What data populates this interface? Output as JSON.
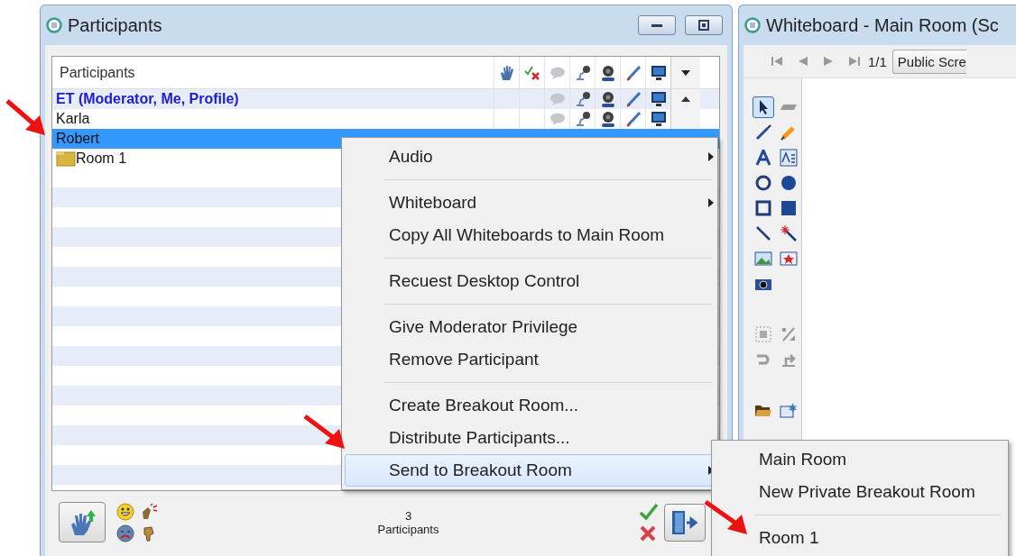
{
  "participants_window": {
    "title": "Participants",
    "list_header": "Participants",
    "rows": [
      {
        "name": "ET (Moderator, Me, Profile)",
        "kind": "moderator",
        "selected": false
      },
      {
        "name": "Karla",
        "kind": "participant",
        "selected": false
      },
      {
        "name": "Robert",
        "kind": "participant",
        "selected": true
      },
      {
        "name": "Room 1",
        "kind": "room",
        "selected": false
      }
    ],
    "count": "3",
    "count_label": "Participants"
  },
  "whiteboard_window": {
    "title": "Whiteboard - Main Room (Sc",
    "page": "1/1",
    "screen_select": "Public Scre"
  },
  "context_menu": {
    "groups": [
      {
        "items": [
          {
            "label": "Audio",
            "submenu": true,
            "selected": false
          }
        ]
      },
      {
        "items": [
          {
            "label": "Whiteboard",
            "submenu": true,
            "selected": false
          },
          {
            "label": "Copy All Whiteboards to Main Room",
            "submenu": false,
            "selected": false
          }
        ]
      },
      {
        "items": [
          {
            "label": "Recuest Desktop Control",
            "submenu": false,
            "selected": false
          }
        ]
      },
      {
        "items": [
          {
            "label": "Give Moderator Privilege",
            "submenu": false,
            "selected": false
          },
          {
            "label": "Remove Participant",
            "submenu": false,
            "selected": false
          }
        ]
      },
      {
        "items": [
          {
            "label": "Create Breakout Room...",
            "submenu": false,
            "selected": false
          },
          {
            "label": "Distribute Participants...",
            "submenu": false,
            "selected": false
          },
          {
            "label": "Send to Breakout Room",
            "submenu": true,
            "selected": true
          }
        ]
      }
    ]
  },
  "submenu": {
    "groups": [
      {
        "items": [
          {
            "label": "Main Room",
            "selected": false
          },
          {
            "label": "New Private Breakout Room",
            "selected": false
          }
        ]
      },
      {
        "items": [
          {
            "label": "Room 1",
            "selected": false
          }
        ]
      }
    ]
  }
}
